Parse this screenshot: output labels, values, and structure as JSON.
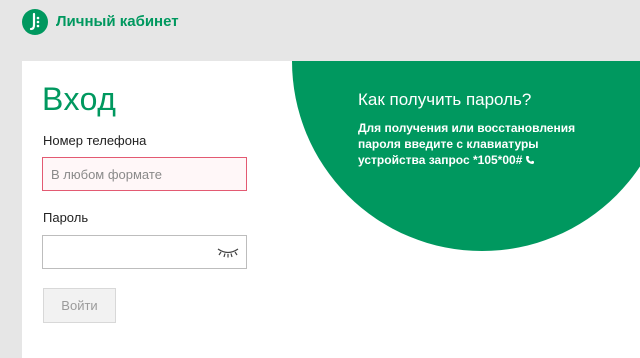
{
  "header": {
    "title": "Личный кабинет",
    "logo_icon": "megafon-logo-icon",
    "brand_color": "#00985f"
  },
  "login": {
    "title": "Вход",
    "phone_label": "Номер телефона",
    "phone_placeholder": "В любом формате",
    "phone_value": "",
    "password_label": "Пароль",
    "password_value": "",
    "show_password_icon": "eye-closed-icon",
    "submit_label": "Войти",
    "submit_enabled": false
  },
  "help": {
    "title": "Как получить пароль?",
    "lines": [
      "Для получения или восстановления",
      "пароля введите с клавиатуры",
      "устройства запрос *105*00#"
    ],
    "phone_icon": "phone-icon"
  },
  "colors": {
    "accent": "#00985f",
    "error_border": "#e35a72",
    "background": "#e6e6e6"
  }
}
